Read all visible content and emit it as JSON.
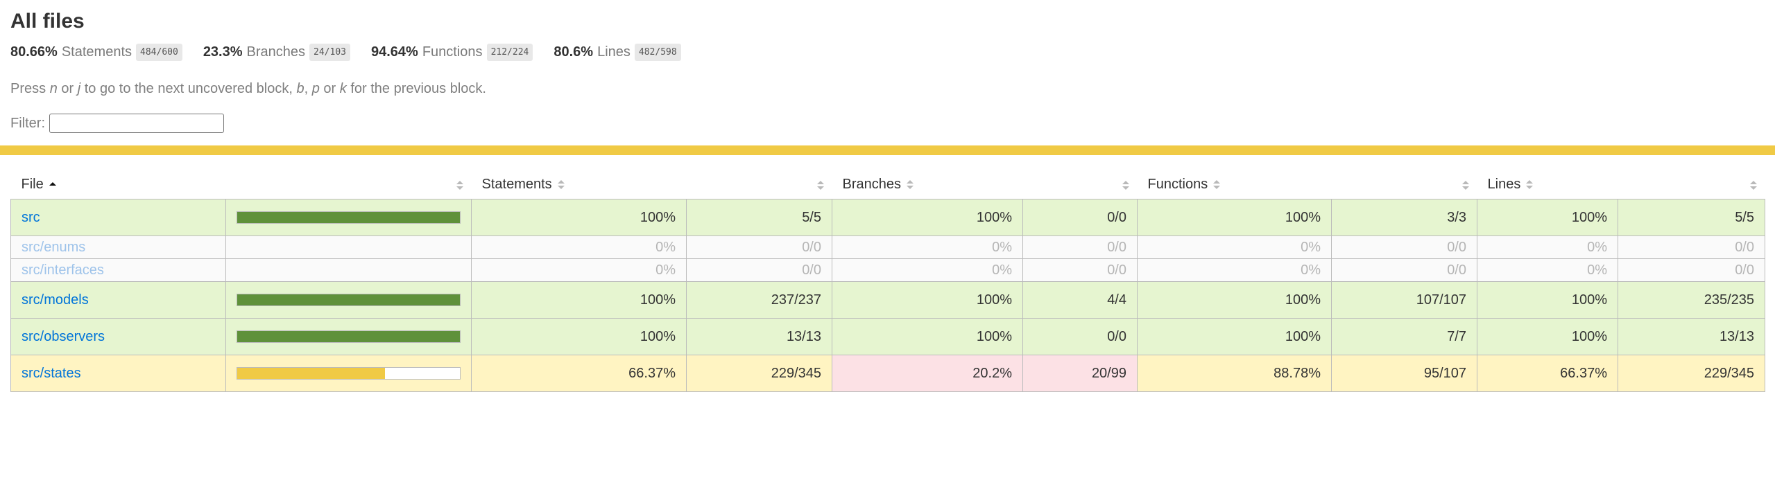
{
  "page_title": "All files",
  "summary": [
    {
      "pct": "80.66%",
      "label": "Statements",
      "fraction": "484/600"
    },
    {
      "pct": "23.3%",
      "label": "Branches",
      "fraction": "24/103"
    },
    {
      "pct": "94.64%",
      "label": "Functions",
      "fraction": "212/224"
    },
    {
      "pct": "80.6%",
      "label": "Lines",
      "fraction": "482/598"
    }
  ],
  "hint": {
    "p1": "Press ",
    "k1": "n",
    "p2": " or ",
    "k2": "j",
    "p3": " to go to the next uncovered block, ",
    "k3": "b",
    "p4": ", ",
    "k4": "p",
    "p5": " or ",
    "k5": "k",
    "p6": " for the previous block."
  },
  "filter": {
    "label": "Filter:",
    "value": ""
  },
  "status_colors": {
    "high": "#e6f5d0",
    "medium": "#fff4c2",
    "low": "#fce1e5",
    "bar_high": "#5f913a",
    "bar_medium": "#f0ca45",
    "status_line": "#f0ca45",
    "link": "#0074d9"
  },
  "headers": {
    "file": "File",
    "statements": "Statements",
    "branches": "Branches",
    "functions": "Functions",
    "lines": "Lines"
  },
  "rows": [
    {
      "file": "src",
      "bar": 1.0,
      "stmt_pct": "100%",
      "stmt": "5/5",
      "br_pct": "100%",
      "br": "0/0",
      "fn_pct": "100%",
      "fn": "3/3",
      "ln_pct": "100%",
      "ln": "5/5"
    },
    {
      "file": "src/enums",
      "bar": 0,
      "stmt_pct": "0%",
      "stmt": "0/0",
      "br_pct": "0%",
      "br": "0/0",
      "fn_pct": "0%",
      "fn": "0/0",
      "ln_pct": "0%",
      "ln": "0/0"
    },
    {
      "file": "src/interfaces",
      "bar": 0,
      "stmt_pct": "0%",
      "stmt": "0/0",
      "br_pct": "0%",
      "br": "0/0",
      "fn_pct": "0%",
      "fn": "0/0",
      "ln_pct": "0%",
      "ln": "0/0"
    },
    {
      "file": "src/models",
      "bar": 1.0,
      "stmt_pct": "100%",
      "stmt": "237/237",
      "br_pct": "100%",
      "br": "4/4",
      "fn_pct": "100%",
      "fn": "107/107",
      "ln_pct": "100%",
      "ln": "235/235"
    },
    {
      "file": "src/observers",
      "bar": 1.0,
      "stmt_pct": "100%",
      "stmt": "13/13",
      "br_pct": "100%",
      "br": "0/0",
      "fn_pct": "100%",
      "fn": "7/7",
      "ln_pct": "100%",
      "ln": "13/13"
    },
    {
      "file": "src/states",
      "bar": 0.6637,
      "stmt_pct": "66.37%",
      "stmt": "229/345",
      "br_pct": "20.2%",
      "br": "20/99",
      "fn_pct": "88.78%",
      "fn": "95/107",
      "ln_pct": "66.37%",
      "ln": "229/345"
    }
  ]
}
